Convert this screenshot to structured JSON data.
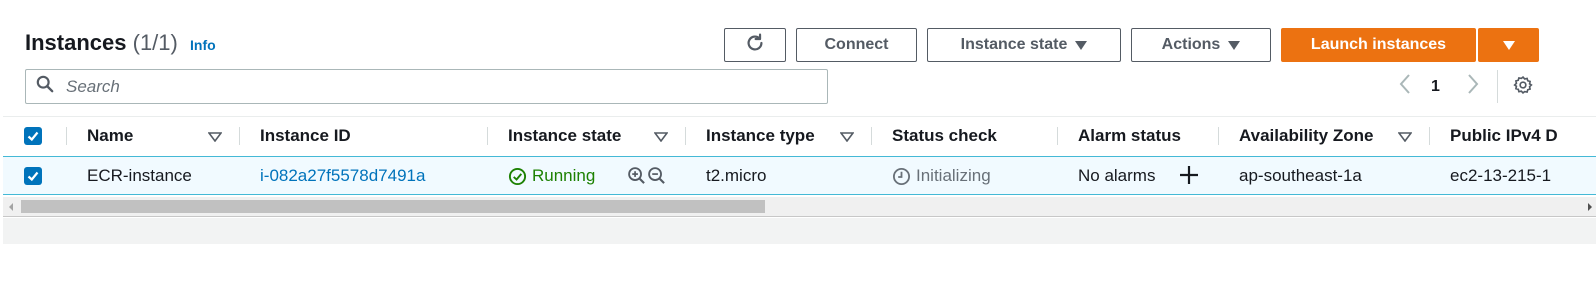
{
  "header": {
    "title": "Instances",
    "count": "(1/1)",
    "info_link": "Info"
  },
  "toolbar": {
    "refresh_icon": "refresh-icon",
    "connect_label": "Connect",
    "instance_state_label": "Instance state",
    "actions_label": "Actions",
    "launch_label": "Launch instances"
  },
  "search": {
    "placeholder": "Search"
  },
  "pagination": {
    "current_page": "1"
  },
  "table": {
    "columns": [
      "Name",
      "Instance ID",
      "Instance state",
      "Instance type",
      "Status check",
      "Alarm status",
      "Availability Zone",
      "Public IPv4 D"
    ],
    "rows": [
      {
        "selected": true,
        "name": "ECR-instance",
        "instance_id": "i-082a27f5578d7491a",
        "state": "Running",
        "type": "t2.micro",
        "status_check": "Initializing",
        "alarm_status": "No alarms",
        "availability_zone": "ap-southeast-1a",
        "public_ipv4": "ec2-13-215-1"
      }
    ]
  },
  "colors": {
    "primary": "#ec7211",
    "link": "#0073bb",
    "running": "#1d8102",
    "selected_row": "#f1faff"
  },
  "scrollbar": {
    "horizontal_position": 0.0
  }
}
